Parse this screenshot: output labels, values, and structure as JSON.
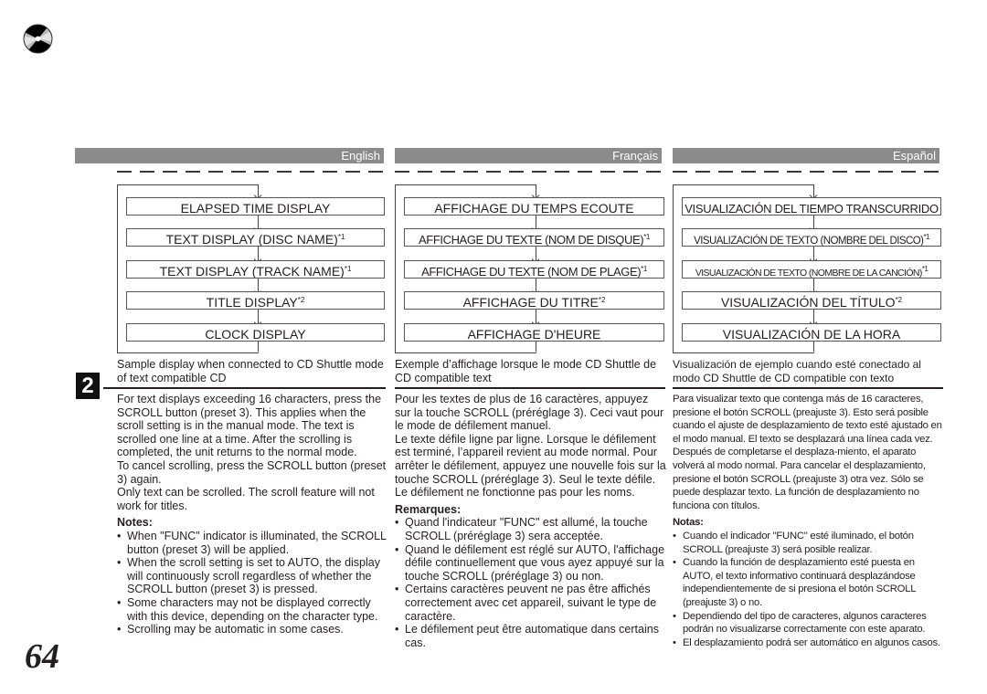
{
  "page": {
    "number": "64",
    "step_badge": "2",
    "icon": "cd-disc-icon"
  },
  "columns": [
    {
      "language": "English",
      "flow": [
        {
          "text": "ELAPSED TIME DISPLAY",
          "note": ""
        },
        {
          "text": "TEXT DISPLAY (DISC NAME)",
          "note": "*1"
        },
        {
          "text": "TEXT DISPLAY (TRACK NAME)",
          "note": "*1"
        },
        {
          "text": "TITLE DISPLAY",
          "note": "*2"
        },
        {
          "text": "CLOCK DISPLAY",
          "note": ""
        }
      ],
      "caption": "Sample display when connected to CD Shuttle mode of text compatible CD",
      "paragraphs": [
        "For text displays exceeding 16 characters, press the SCROLL button (preset 3). This applies when the scroll setting is in the manual mode. The text is scrolled one line at a time. After the scrolling is completed, the unit returns to the normal mode.",
        "To cancel scrolling, press the SCROLL button (preset 3) again.",
        "Only text can be scrolled. The scroll feature will not work for titles."
      ],
      "notes_heading": "Notes:",
      "notes": [
        "When \"FUNC\" indicator is illuminated, the SCROLL button (preset 3) will be applied.",
        "When the scroll setting is set to AUTO, the display will continuously scroll regardless of whether the SCROLL button (preset 3) is pressed.",
        "Some characters may not be displayed correctly with this device, depending on the character type.",
        "Scrolling may be automatic in some cases."
      ]
    },
    {
      "language": "Français",
      "flow": [
        {
          "text": "AFFICHAGE DU TEMPS ECOUTE",
          "note": ""
        },
        {
          "text": "AFFICHAGE DU TEXTE (NOM DE DISQUE)",
          "note": "*1"
        },
        {
          "text": "AFFICHAGE DU TEXTE (NOM DE PLAGE)",
          "note": "*1"
        },
        {
          "text": "AFFICHAGE DU TITRE",
          "note": "*2"
        },
        {
          "text": "AFFICHAGE D'HEURE",
          "note": ""
        }
      ],
      "caption": "Exemple d’affichage lorsque le mode CD Shuttle de CD compatible text",
      "paragraphs": [
        "Pour les textes de plus de 16 caractères, appuyez sur la touche SCROLL (préréglage 3). Ceci vaut pour le mode de défilement manuel.",
        "Le texte défile ligne par ligne. Lorsque le défilement est terminé, l’appareil revient au mode normal. Pour arrêter le défilement, appuyez une nouvelle fois sur la touche SCROLL (préréglage 3). Seul le texte défile. Le défilement ne fonctionne pas pour les noms."
      ],
      "notes_heading": "Remarques:",
      "notes": [
        "Quand l'indicateur \"FUNC\" est allumé, la touche SCROLL (préréglage 3) sera acceptée.",
        "Quand le défilement est réglé sur AUTO, l'affichage défile continuellement que vous ayez appuyé sur la touche SCROLL (préréglage 3) ou non.",
        "Certains caractères peuvent ne pas être affichés correctement avec cet appareil, suivant le type de caractère.",
        "Le défilement peut être automatique dans certains cas."
      ]
    },
    {
      "language": "Español",
      "flow": [
        {
          "text": "VISUALIZACIÓN DEL TIEMPO TRANSCURRIDO",
          "note": ""
        },
        {
          "text": "VISUALIZACIÓN DE TEXTO (NOMBRE DEL DISCO)",
          "note": "*1"
        },
        {
          "text": "VISUALIZACIÓN DE TEXTO (NOMBRE DE LA CANCIÓN)",
          "note": "*1"
        },
        {
          "text": "VISUALIZACIÓN DEL TÍTULO",
          "note": "*2"
        },
        {
          "text": "VISUALIZACIÓN DE LA HORA",
          "note": ""
        }
      ],
      "caption": "Visualización de ejemplo cuando esté conectado al modo CD Shuttle de CD compatible con texto",
      "paragraphs": [
        "Para visualizar texto que contenga más de 16 caracteres, presione el botón SCROLL (preajuste 3). Esto será posible cuando el ajuste de desplazamiento de texto esté ajustado en el modo manual. El texto se desplazará una línea cada vez. Después de completarse el desplaza-miento, el aparato volverá al modo normal. Para cancelar el desplazamiento, presione el botón SCROLL (preajuste 3) otra vez. Sólo se puede desplazar texto. La función de desplazamiento no funciona con títulos."
      ],
      "notes_heading": "Notas:",
      "notes": [
        "Cuando el indicador \"FUNC\" esté iluminado, el botón SCROLL (preajuste 3) será posible realizar.",
        "Cuando la función de desplazamiento esté puesta en AUTO, el texto informativo continuará desplazándose independientemente de si presiona el botón SCROLL (preajuste 3) o no.",
        "Dependiendo del tipo de caracteres, algunos caracteres podrán no visualizarse correctamente con este aparato.",
        "El desplazamiento podrá ser automático en algunos casos."
      ]
    }
  ]
}
